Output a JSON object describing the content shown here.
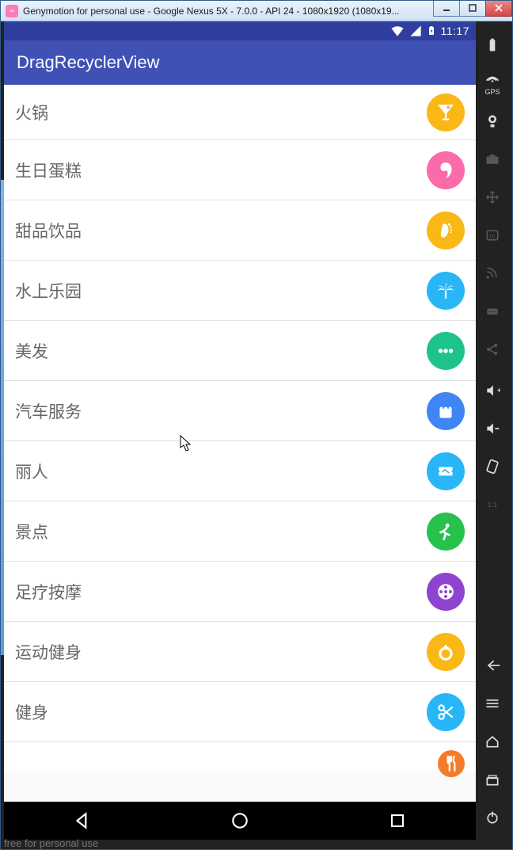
{
  "window": {
    "title": "Genymotion for personal use - Google Nexus 5X - 7.0.0 - API 24 - 1080x1920 (1080x19..."
  },
  "statusbar": {
    "time": "11:17"
  },
  "appbar": {
    "title": "DragRecyclerView"
  },
  "rows": [
    {
      "label": "火锅",
      "icon": "cocktail",
      "color": "#f9b816"
    },
    {
      "label": "生日蛋糕",
      "icon": "profile",
      "color": "#fb6aa9"
    },
    {
      "label": "甜品饮品",
      "icon": "foot",
      "color": "#f9b816"
    },
    {
      "label": "水上乐园",
      "icon": "palm",
      "color": "#29b6f6"
    },
    {
      "label": "美发",
      "icon": "more",
      "color": "#1ec28b"
    },
    {
      "label": "汽车服务",
      "icon": "bag",
      "color": "#3f85f4"
    },
    {
      "label": "丽人",
      "icon": "ticket",
      "color": "#29b6f6"
    },
    {
      "label": "景点",
      "icon": "run",
      "color": "#27c24c"
    },
    {
      "label": "足疗按摩",
      "icon": "reel",
      "color": "#8e44d0"
    },
    {
      "label": "运动健身",
      "icon": "ring",
      "color": "#f9b816"
    },
    {
      "label": "健身",
      "icon": "scissor",
      "color": "#29b6f6"
    }
  ],
  "partial_row": {
    "icon": "fork",
    "color": "#f47b2a"
  },
  "sidebar": {
    "gps_label": "GPS",
    "ratio_label": "1:1"
  },
  "footer": "free for personal use"
}
